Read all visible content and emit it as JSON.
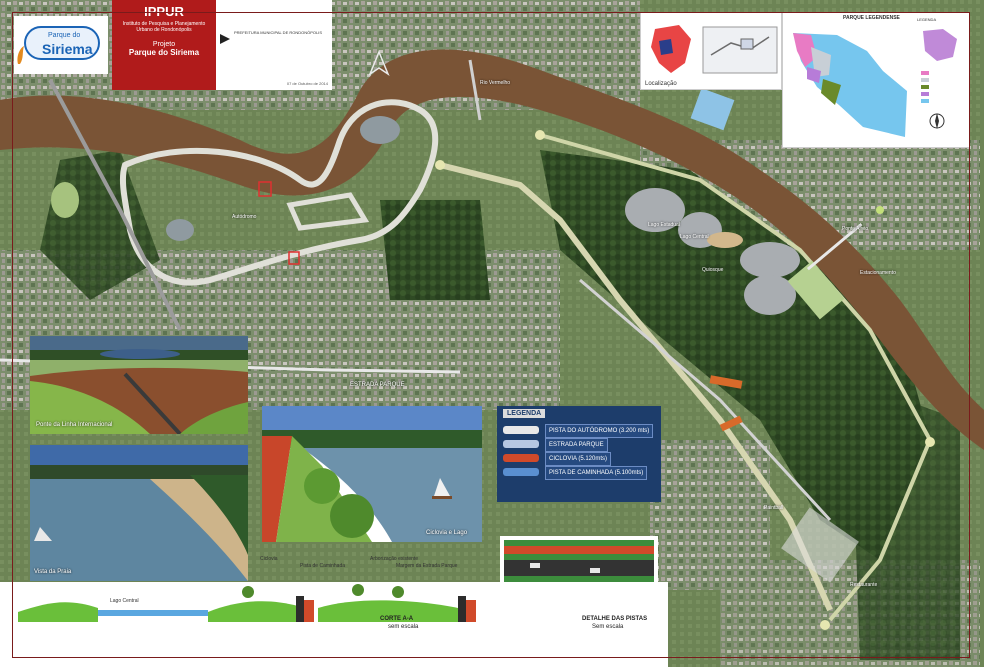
{
  "header": {
    "logo_small": "Parque do",
    "logo_big": "Siriema",
    "institute_short": "IPPUR",
    "institute_full": "Instituto de Pesquisa e Planejamento Urbano de Rondonópolis",
    "project_label": "Projeto",
    "project_name": "Parque do Siriema",
    "credits": "PREFEITURA MUNICIPAL DE RONDONÓPOLIS",
    "date": "07 de Outubro de 2014"
  },
  "location": {
    "label": "Localização"
  },
  "park_map": {
    "title": "PARQUE LEGENDENSE",
    "legend_title": "LEGENDA"
  },
  "map_labels": {
    "autodromo": "Autódromo",
    "rio": "Rio Vermelho",
    "lago_central": "Lago Central",
    "lago_estadual": "Lago Estadual",
    "quiosque": "Quiosque",
    "restaurante": "Restaurante",
    "estacionamento": "Estacionamento",
    "ponte": "Ponte Alivio",
    "estrada": "ESTRADA PARQUE",
    "paintball": "Paintball"
  },
  "photos": {
    "ponte_label": "Ponte da Linha Internacional",
    "praia_label": "Vista da Praia",
    "ciclovia_label": "Ciclovia e Lago"
  },
  "legend": {
    "title": "LEGENDA",
    "items": [
      {
        "label": "PISTA DO AUTÓDROMO (3.200 mts)",
        "color": "#e8e8e8"
      },
      {
        "label": "ESTRADA PARQUE",
        "color": "#b6c7e2"
      },
      {
        "label": "CICLOVIA (5.120mts)",
        "color": "#d04a2a"
      },
      {
        "label": "PISTA DE CAMINHADA (5.100mts)",
        "color": "#5a8fd0"
      }
    ]
  },
  "section_a": {
    "title": "CORTE A-A",
    "subtitle": "sem escala",
    "labels": [
      "Ciclovia",
      "Pista de Caminhada",
      "Arborização existente",
      "Margem da Estrada Parque",
      "Lago Central"
    ]
  },
  "section_tracks": {
    "title": "DETALHE DAS PISTAS",
    "subtitle": "Sem escala"
  }
}
